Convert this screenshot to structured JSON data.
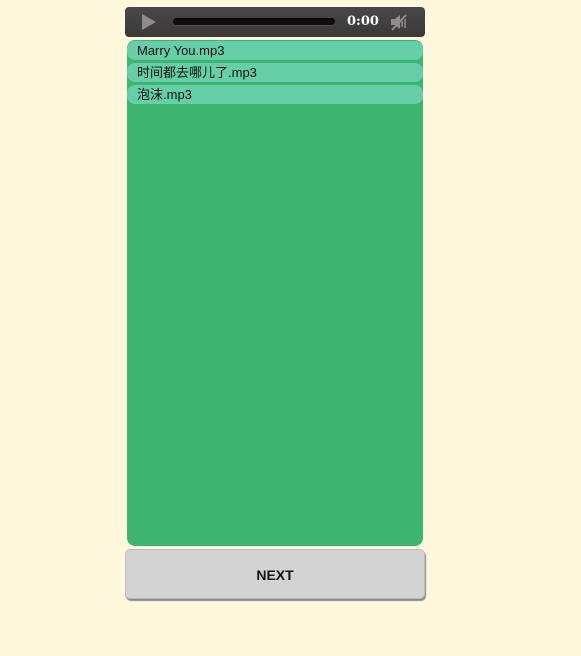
{
  "player": {
    "time": "0:00",
    "progress": 0,
    "play_icon": "play-icon",
    "mute_icon": "mute-icon"
  },
  "playlist": {
    "tracks": [
      {
        "label": "Marry You.mp3"
      },
      {
        "label": "时间都去哪儿了.mp3"
      },
      {
        "label": "泡沫.mp3"
      }
    ]
  },
  "controls": {
    "next_label": "NEXT"
  },
  "colors": {
    "page_background": "#fff8dc",
    "playlist_background": "#3db470",
    "track_item_background": "#66cea9",
    "player_background": "#3e3d3b",
    "next_button_background": "#d3d3d3"
  }
}
